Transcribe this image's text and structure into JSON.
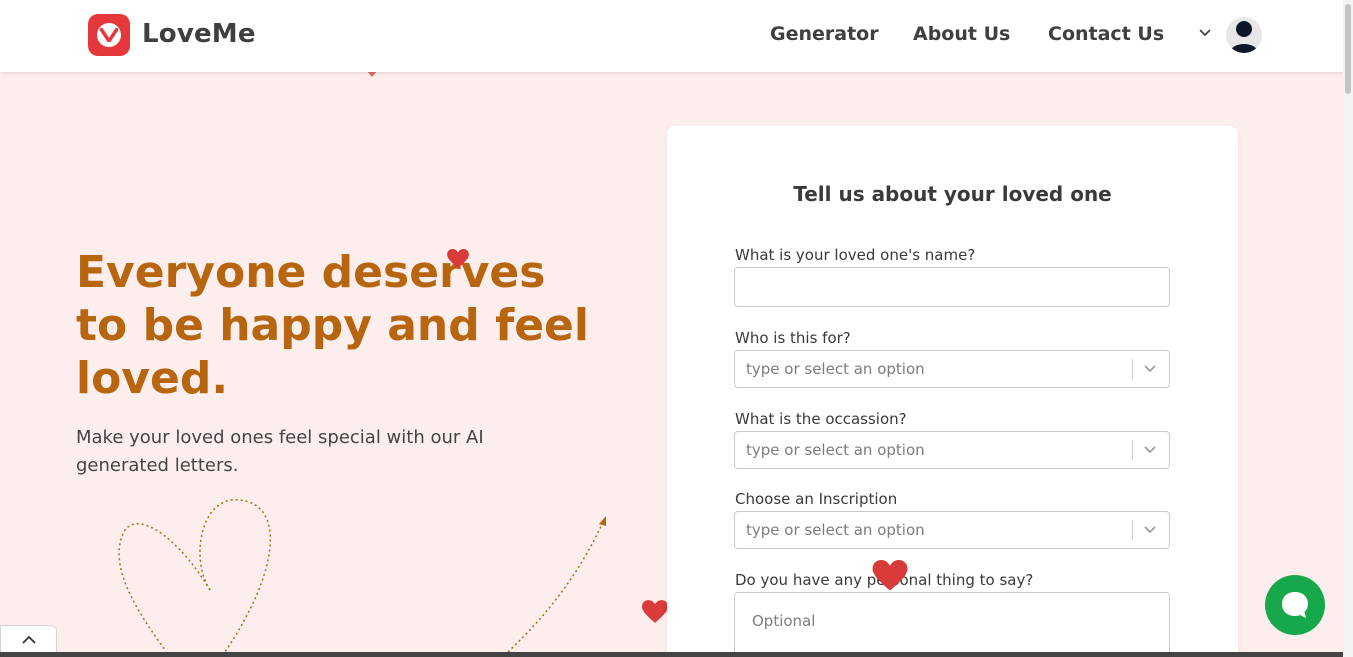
{
  "brand": {
    "name": "LoveMe",
    "logo_icon": "v-heart-logo-icon",
    "color": "#e5383b"
  },
  "nav": {
    "items": [
      {
        "label": "Generator"
      },
      {
        "label": "About Us"
      },
      {
        "label": "Contact Us"
      }
    ],
    "dropdown_icon": "chevron-down-icon",
    "avatar_icon": "user-avatar-icon"
  },
  "hero": {
    "title": "Everyone deserves to be happy and feel loved.",
    "subtitle": "Make your loved ones feel special with our AI generated letters.",
    "title_color": "#b8650f"
  },
  "form": {
    "title": "Tell us about your loved one",
    "name_label": "What is your loved one's name?",
    "name_value": "",
    "recipient_label": "Who is this for?",
    "recipient_placeholder": "type or select an option",
    "occasion_label": "What is the occassion?",
    "occasion_placeholder": "type or select an option",
    "inscription_label": "Choose an Inscription",
    "inscription_placeholder": "type or select an option",
    "personal_label": "Do you have any personal thing to say?",
    "personal_placeholder": "Optional"
  },
  "widgets": {
    "chat_icon": "chat-bubble-icon",
    "scroll_top_icon": "chevron-up-icon",
    "chat_color": "#17a84b"
  },
  "colors": {
    "background": "#fdeeee",
    "heart": "#d93a3a"
  }
}
